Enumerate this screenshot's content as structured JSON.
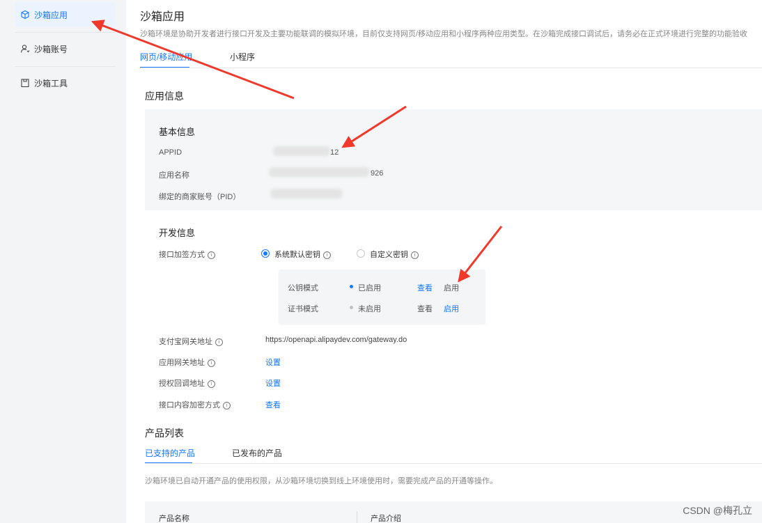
{
  "sidebar": {
    "items": [
      {
        "label": "沙箱应用",
        "icon": "cube-icon",
        "active": true
      },
      {
        "label": "沙箱账号",
        "icon": "user-icon",
        "active": false
      },
      {
        "label": "沙箱工具",
        "icon": "toolbox-icon",
        "active": false
      }
    ]
  },
  "page": {
    "title": "沙箱应用",
    "description": "沙箱环境是协助开发者进行接口开发及主要功能联调的模拟环境，目前仅支持网页/移动应用和小程序两种应用类型。在沙箱完成接口调试后，请务必在正式环境进行完整的功能验收"
  },
  "app_tabs": [
    {
      "label": "网页/移动应用",
      "active": true
    },
    {
      "label": "小程序",
      "active": false
    }
  ],
  "app_info": {
    "section_title": "应用信息",
    "basic": {
      "title": "基本信息",
      "appid_label": "APPID",
      "appid_visible": "12",
      "name_label": "应用名称",
      "name_visible": "926",
      "pid_label": "绑定的商家账号（PID）"
    },
    "dev": {
      "title": "开发信息",
      "sign_label": "接口加签方式",
      "option_default": "系统默认密钥",
      "option_custom": "自定义密钥",
      "modes": [
        {
          "name": "公钥模式",
          "status": "已启用",
          "status_color": "#1677ff",
          "view": "查看",
          "view_link": true,
          "enable": "启用",
          "enable_link": false
        },
        {
          "name": "证书模式",
          "status": "未启用",
          "status_color": "#c0c0c0",
          "view": "查看",
          "view_link": false,
          "enable": "启用",
          "enable_link": true
        }
      ],
      "gateway_label": "支付宝网关地址",
      "gateway_value": "https://openapi.alipaydev.com/gateway.do",
      "app_gateway_label": "应用网关地址",
      "app_gateway_action": "设置",
      "callback_label": "授权回调地址",
      "callback_action": "设置",
      "encrypt_label": "接口内容加密方式",
      "encrypt_action": "查看"
    }
  },
  "products": {
    "title": "产品列表",
    "tabs": [
      {
        "label": "已支持的产品",
        "active": true
      },
      {
        "label": "已发布的产品",
        "active": false
      }
    ],
    "note": "沙箱环境已自动开通产品的使用权限，从沙箱环境切换到线上环境使用时，需要完成产品的开通等操作。",
    "columns": [
      "产品名称",
      "产品介绍"
    ]
  },
  "watermark": "CSDN @梅孔立",
  "colors": {
    "accent": "#1677ff",
    "annotation": "#f0392b"
  }
}
